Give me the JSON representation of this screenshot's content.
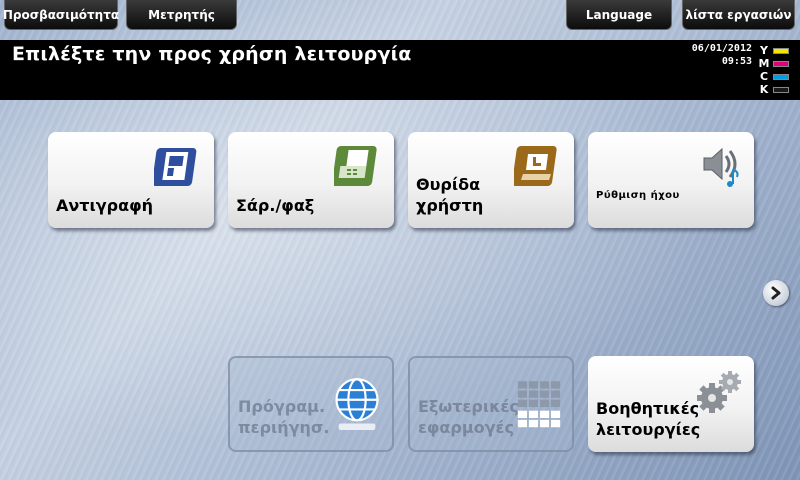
{
  "top_buttons": {
    "accessibility": "Προσβασιμότητα",
    "counter": "Μετρητής",
    "language": "Language",
    "job_list": "λίστα εργασιών"
  },
  "header": {
    "title": "Επιλέξτε την προς χρήση λειτουργία",
    "date": "06/01/2012",
    "time": "09:53"
  },
  "toner": [
    {
      "letter": "Y",
      "color": "#f5e400"
    },
    {
      "letter": "M",
      "color": "#e2007a"
    },
    {
      "letter": "C",
      "color": "#009fe3"
    },
    {
      "letter": "K",
      "color": "#1a1a1a"
    }
  ],
  "tiles": {
    "copy": {
      "label": "Αντιγραφή",
      "icon": "copy-icon",
      "color": "#2f4f9e"
    },
    "scan_fax": {
      "label": "Σάρ./φαξ",
      "icon": "scan-fax-icon",
      "color": "#5d8a3a"
    },
    "user_box": {
      "label_line1": "Θυρίδα",
      "label_line2": "χρήστη",
      "icon": "user-box-icon",
      "color": "#9a6a1a"
    },
    "sound": {
      "label": "Ρύθμιση ήχου",
      "icon": "speaker-icon"
    },
    "browser": {
      "label_line1": "Πρόγραμ.",
      "label_line2": "περιήγησ.",
      "icon": "globe-icon",
      "enabled": false
    },
    "external_apps": {
      "label_line1": "Εξωτερικές",
      "label_line2": "εφαρμογές",
      "icon": "apps-grid-icon",
      "enabled": false
    },
    "utility": {
      "label_line1": "Βοηθητικές",
      "label_line2": "λειτουργίες",
      "icon": "gears-icon"
    }
  },
  "navigation": {
    "next_icon": "chevron-right-icon"
  }
}
